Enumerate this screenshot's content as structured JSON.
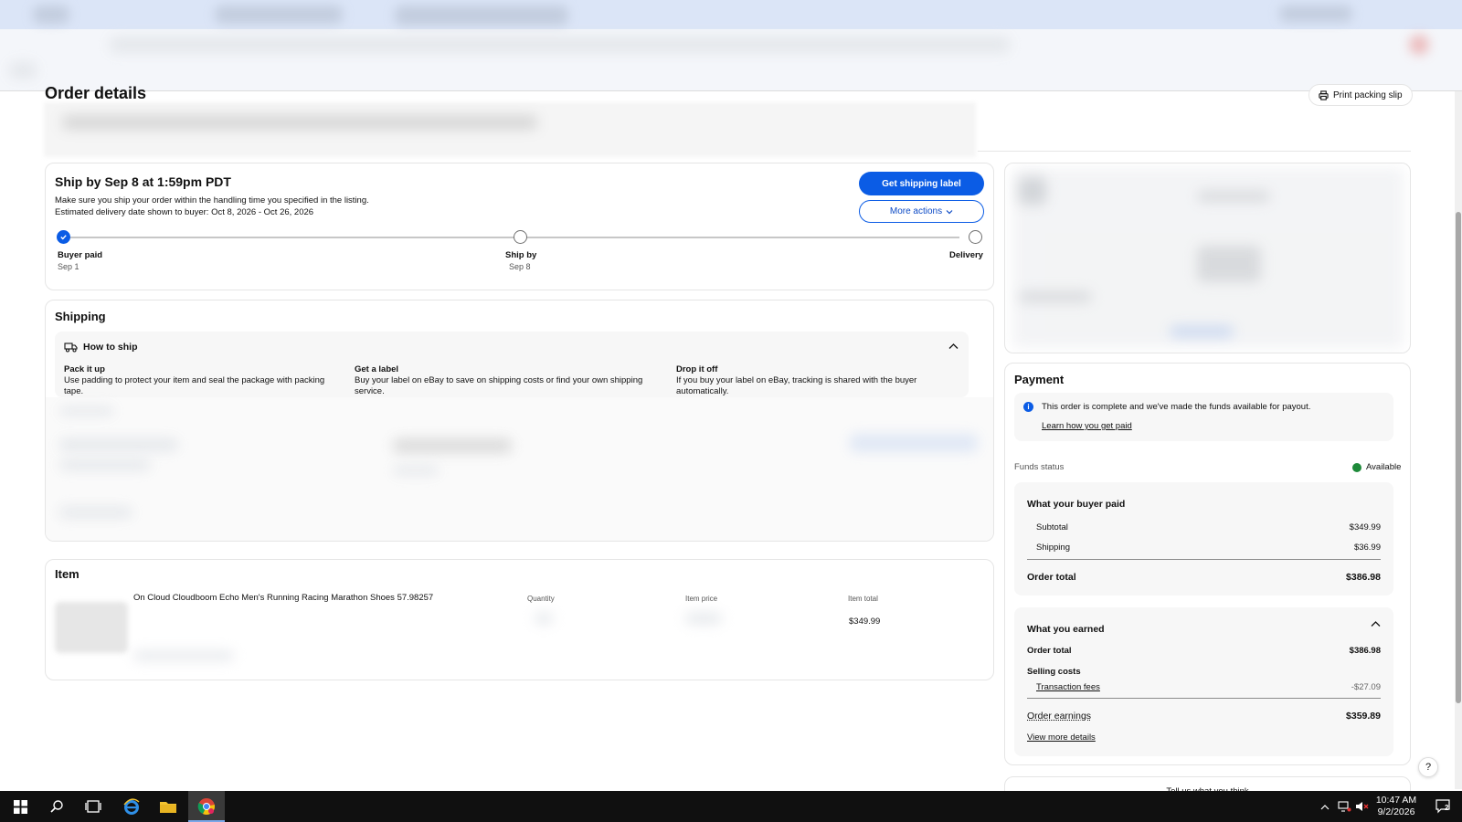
{
  "page": {
    "title": "Order details",
    "print_label": "Print packing slip"
  },
  "ship_card": {
    "title": "Ship by Sep 8 at 1:59pm PDT",
    "desc_line1": "Make sure you ship your order within the handling time you specified in the listing.",
    "desc_line2": "Estimated delivery date shown to buyer: Oct 8, 2026 - Oct 26, 2026",
    "primary_button": "Get shipping label",
    "secondary_button": "More actions",
    "steps": [
      {
        "label": "Buyer paid",
        "date": "Sep 1"
      },
      {
        "label": "Ship by",
        "date": "Sep 8"
      },
      {
        "label": "Delivery",
        "date": ""
      }
    ]
  },
  "shipping": {
    "title": "Shipping",
    "how_title": "How to ship",
    "cols": [
      {
        "title": "Pack it up",
        "text": "Use padding to protect your item and seal the package with packing tape."
      },
      {
        "title": "Get a label",
        "text": "Buy your label on eBay to save on shipping costs or find your own shipping service."
      },
      {
        "title": "Drop it off",
        "text": "If you buy your label on eBay, tracking is shared with the buyer automatically."
      }
    ]
  },
  "item": {
    "title": "Item",
    "name": "On Cloud Cloudboom Echo Men's Running Racing Marathon Shoes 57.98257",
    "headers": {
      "quantity": "Quantity",
      "item_price": "Item price",
      "item_total": "Item total"
    },
    "total": "$349.99"
  },
  "payment": {
    "title": "Payment",
    "info_text": "This order is complete and we've made the funds available for payout.",
    "info_link": "Learn how you get paid",
    "funds_label": "Funds status",
    "funds_value": "Available",
    "buyer_paid": {
      "title": "What your buyer paid",
      "subtotal_label": "Subtotal",
      "subtotal": "$349.99",
      "shipping_label": "Shipping",
      "shipping": "$36.99",
      "total_label": "Order total",
      "total": "$386.98"
    },
    "earned": {
      "title": "What you earned",
      "order_total_label": "Order total",
      "order_total": "$386.98",
      "selling_costs_label": "Selling costs",
      "fees_label": "Transaction fees",
      "fees": "-$27.09",
      "earnings_label": "Order earnings",
      "earnings": "$359.89",
      "view_more": "View more details"
    },
    "feedback": "Tell us what you think"
  },
  "help": "?",
  "taskbar": {
    "time": "10:47 AM",
    "date": "9/2/2026",
    "notifications": "2"
  },
  "colors": {
    "accent": "#0b5ce5",
    "available": "#1e8a3a",
    "taskbar": "#101010"
  }
}
